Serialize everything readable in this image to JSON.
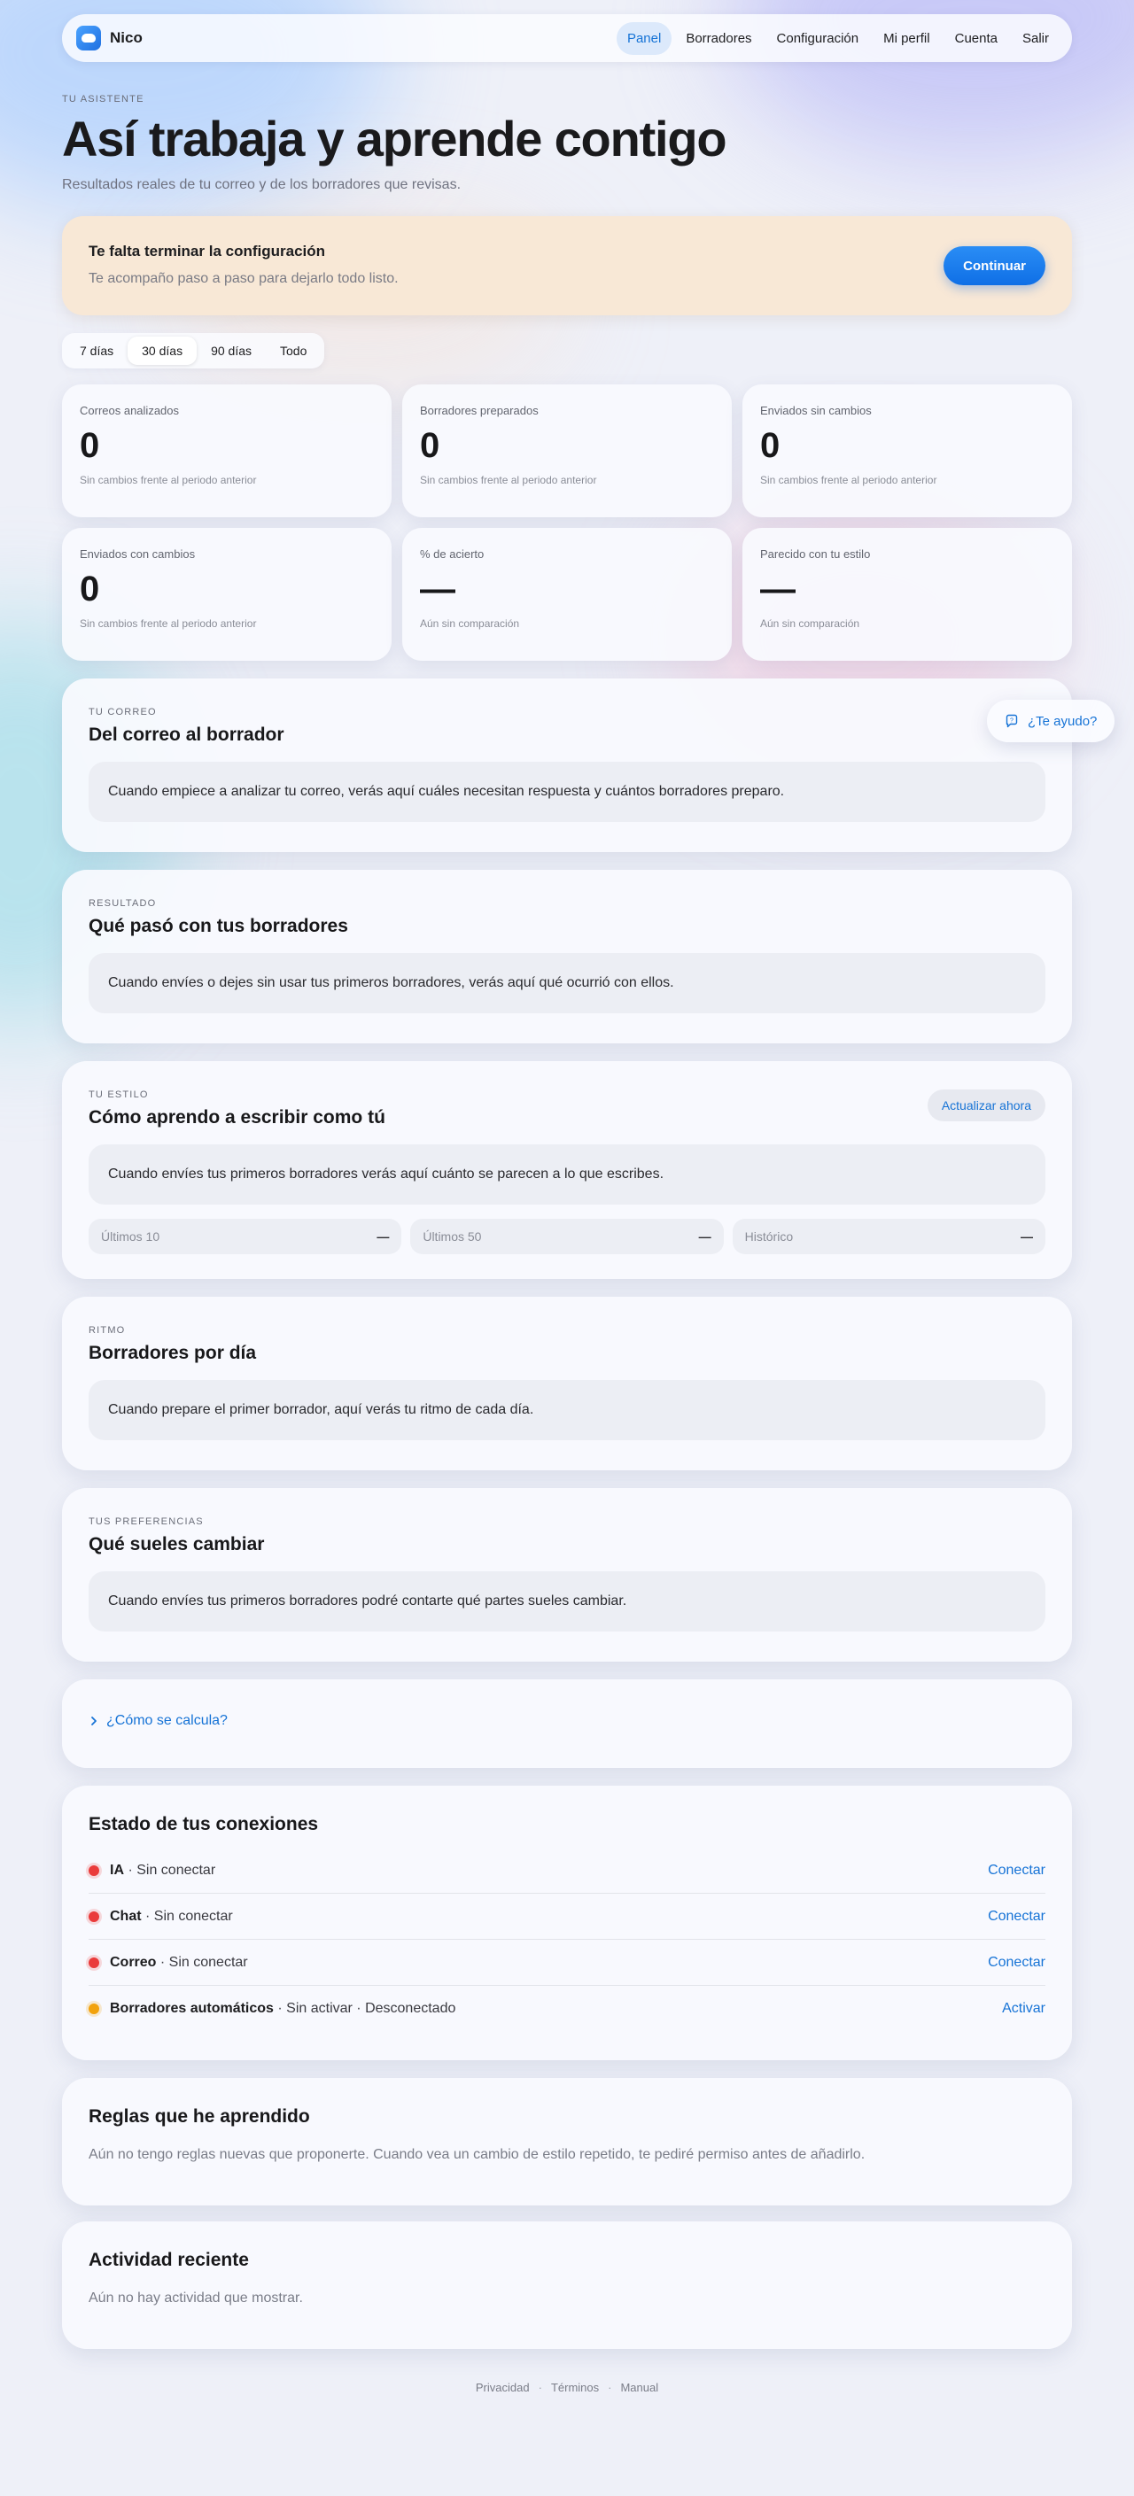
{
  "brand": {
    "name": "Nico"
  },
  "nav": {
    "items": [
      "Panel",
      "Borradores",
      "Configuración",
      "Mi perfil",
      "Cuenta",
      "Salir"
    ],
    "active": "Panel"
  },
  "header": {
    "eyebrow": "TU ASISTENTE",
    "title": "Así trabaja y aprende contigo",
    "subtitle": "Resultados reales de tu correo y de los borradores que revisas."
  },
  "setup": {
    "title": "Te falta terminar la configuración",
    "text": "Te acompaño paso a paso para dejarlo todo listo.",
    "button": "Continuar"
  },
  "period": {
    "options": [
      "7 días",
      "30 días",
      "90 días",
      "Todo"
    ],
    "selected": "30 días"
  },
  "stats": [
    {
      "label": "Correos analizados",
      "value": "0",
      "note": "Sin cambios frente al periodo anterior"
    },
    {
      "label": "Borradores preparados",
      "value": "0",
      "note": "Sin cambios frente al periodo anterior"
    },
    {
      "label": "Enviados sin cambios",
      "value": "0",
      "note": "Sin cambios frente al periodo anterior"
    },
    {
      "label": "Enviados con cambios",
      "value": "0",
      "note": "Sin cambios frente al periodo anterior"
    },
    {
      "label": "% de acierto",
      "value": "—",
      "note": "Aún sin comparación"
    },
    {
      "label": "Parecido con tu estilo",
      "value": "—",
      "note": "Aún sin comparación"
    }
  ],
  "sections": {
    "mail": {
      "eyebrow": "TU CORREO",
      "title": "Del correo al borrador",
      "empty": "Cuando empiece a analizar tu correo, verás aquí cuáles necesitan respuesta y cuántos borradores preparo."
    },
    "result": {
      "eyebrow": "RESULTADO",
      "title": "Qué pasó con tus borradores",
      "empty": "Cuando envíes o dejes sin usar tus primeros borradores, verás aquí qué ocurrió con ellos."
    },
    "style": {
      "eyebrow": "TU ESTILO",
      "title": "Cómo aprendo a escribir como tú",
      "button": "Actualizar ahora",
      "empty": "Cuando envíes tus primeros borradores verás aquí cuánto se parecen a lo que escribes.",
      "metrics": [
        {
          "label": "Últimos 10",
          "value": "—"
        },
        {
          "label": "Últimos 50",
          "value": "—"
        },
        {
          "label": "Histórico",
          "value": "—"
        }
      ]
    },
    "rhythm": {
      "eyebrow": "RITMO",
      "title": "Borradores por día",
      "empty": "Cuando prepare el primer borrador, aquí verás tu ritmo de cada día."
    },
    "prefs": {
      "eyebrow": "TUS PREFERENCIAS",
      "title": "Qué sueles cambiar",
      "empty": "Cuando envíes tus primeros borradores podré contarte qué partes sueles cambiar."
    }
  },
  "howto": {
    "label": "¿Cómo se calcula?"
  },
  "connections": {
    "title": "Estado de tus conexiones",
    "items": [
      {
        "name": "IA",
        "state": " · Sin conectar",
        "action": "Conectar",
        "status_color": "#ea3b3b"
      },
      {
        "name": "Chat",
        "state": " · Sin conectar",
        "action": "Conectar",
        "status_color": "#ea3b3b"
      },
      {
        "name": "Correo",
        "state": " · Sin conectar",
        "action": "Conectar",
        "status_color": "#ea3b3b"
      },
      {
        "name": "Borradores automáticos",
        "state": " · Sin activar · Desconectado",
        "action": "Activar",
        "status_color": "#f2a20c"
      }
    ]
  },
  "rules": {
    "title": "Reglas que he aprendido",
    "text": "Aún no tengo reglas nuevas que proponerte. Cuando vea un cambio de estilo repetido, te pediré permiso antes de añadirlo."
  },
  "activity": {
    "title": "Actividad reciente",
    "text": "Aún no hay actividad que mostrar."
  },
  "help": {
    "label": "¿Te ayudo?"
  },
  "footer": {
    "links": [
      "Privacidad",
      "Términos",
      "Manual"
    ],
    "separator": "·"
  },
  "colors": {
    "accent": "#1673d6",
    "primary_button": "#0f6fe6",
    "setup_bg": "#f8e8d6"
  }
}
